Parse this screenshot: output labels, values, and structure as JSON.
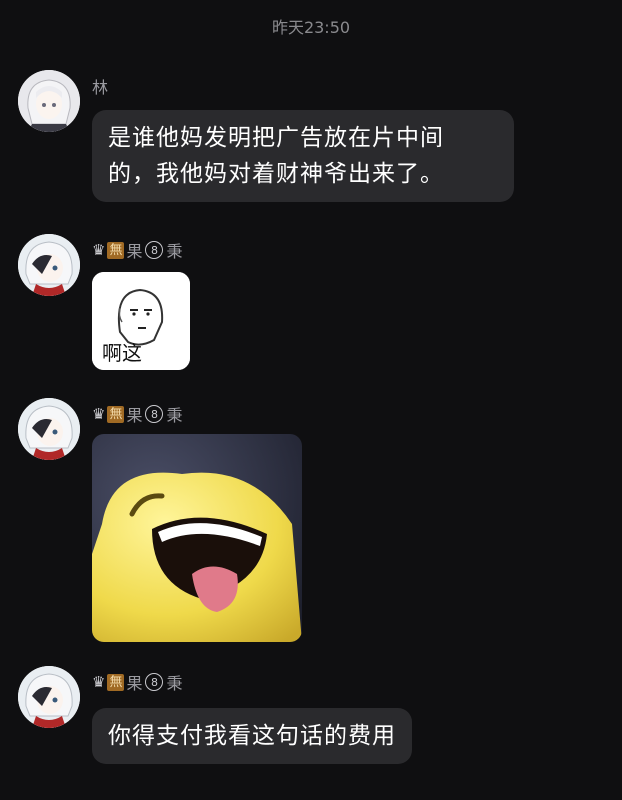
{
  "chat": {
    "timestamp": "昨天23:50",
    "messages": [
      {
        "sender": "林",
        "text_line1": "是谁他妈发明把广告放在片中间",
        "text_line2": "的，我他妈对着财神爷出来了。"
      },
      {
        "sender_prefix": "♛",
        "sender_badge": "無",
        "sender_mid": "果",
        "sender_circle": "8",
        "sender_suffix": "秉",
        "sticker_caption": "啊这"
      },
      {
        "sender_prefix": "♛",
        "sender_badge": "無",
        "sender_mid": "果",
        "sender_circle": "8",
        "sender_suffix": "秉"
      },
      {
        "sender_prefix": "♛",
        "sender_badge": "無",
        "sender_mid": "果",
        "sender_circle": "8",
        "sender_suffix": "秉",
        "text": "你得支付我看这句话的费用"
      }
    ]
  }
}
